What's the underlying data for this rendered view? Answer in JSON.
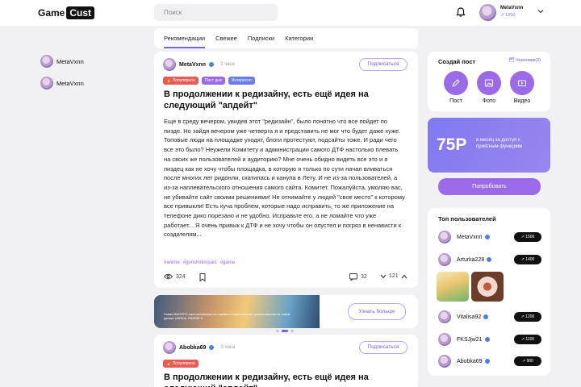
{
  "header": {
    "logo_part1": "Game",
    "logo_part2": "Cust",
    "search_placeholder": "Поиск",
    "user_name": "MetaVxnn",
    "user_rating": "↗ 1250"
  },
  "sidebar": {
    "subscriptions": [
      {
        "name": "MetaVxnn"
      },
      {
        "name": "MetaVxnn"
      }
    ]
  },
  "tabs": [
    "Рекомендации",
    "Свежее",
    "Подписки",
    "Категории"
  ],
  "post1": {
    "author": "MetaVxnn",
    "time": "3 часа",
    "subscribe_label": "Подписаться",
    "tags": [
      "🔥 Популярное",
      "Пост дня",
      "Интересно"
    ],
    "title": "В продолжении к редизайну, есть ещё идея на следующий \"апдейт\"",
    "body": "Еще в среду вечером, увидев этот \"редизайн\", было понятно что все пойдет по пизде. Но зайдя вечером уже четверга я и представить не мог что будет даже хуже. Топовые люди на площадке уходят, блоги протестуют, подсайты тоже. И ради чего все это было? Неужели Комитету и администрации самого ДТФ настолько плевать на своих же пользователей и аудиторию? Мне очень обидно видеть все это и я пиздец как не хочу чтобы площадка, в которую я только по сути начал вливаться после многих лет ридонли, скатилась и канула в Лету. И не из-за пользователей, а из-за наплевательского отношения самого сайта. Комитет. Пожалуйста, умоляю вас, не убивайте сайт своими решениями! Не отнимайте у людей \"свое место\" к которому все привыкли! Есть куча проблем, которые надо исправить, то же приложение на телефоне дико порезано и не удобно. Исправьте его, а не ломайте что уже работает... Я очень привык к ДТФ и не хочу чтобы он опустел и погряз в ненависти к создателям...",
    "hashtags": [
      "#anime",
      "#genshinimpact",
      "#game"
    ],
    "views": "324",
    "comments": "32",
    "votes": "121"
  },
  "banner": {
    "text": "Новая MMORPG игра основанная на стройке и строительстве, реализованная на новом движке UNREAL ENGINE 5",
    "button": "Узнать больше"
  },
  "post2": {
    "author": "Abobka69",
    "time": "3 часа",
    "subscribe_label": "Подписаться",
    "tags": [
      "🔥 Популярное"
    ],
    "title": "В продолжении к редизайну, есть ещё идея на следующий \"апдейт\""
  },
  "create": {
    "title": "Создай пост",
    "drafts": "🗂 Черновик(2)",
    "items": [
      "Пост",
      "Фото",
      "Видео"
    ]
  },
  "promo": {
    "price": "75Р",
    "text": "в месяц за доступ к приятным функциям",
    "button": "Попробовать"
  },
  "top_users": {
    "title": "Топ пользователей",
    "users": [
      {
        "name": "MetaVxnn",
        "score": "↗ 1500"
      },
      {
        "name": "Arturka228",
        "score": "↗ 1400"
      },
      {
        "name": "Vitalisa92",
        "score": "↗ 1200"
      },
      {
        "name": "FKSJjw21",
        "score": "↗ 1100"
      },
      {
        "name": "Abobka69",
        "score": "↗ 900"
      }
    ]
  },
  "colors": {
    "accent": "#7b5cf0",
    "accent_button": "#9a6ae8",
    "background": "#f1f1f3"
  }
}
